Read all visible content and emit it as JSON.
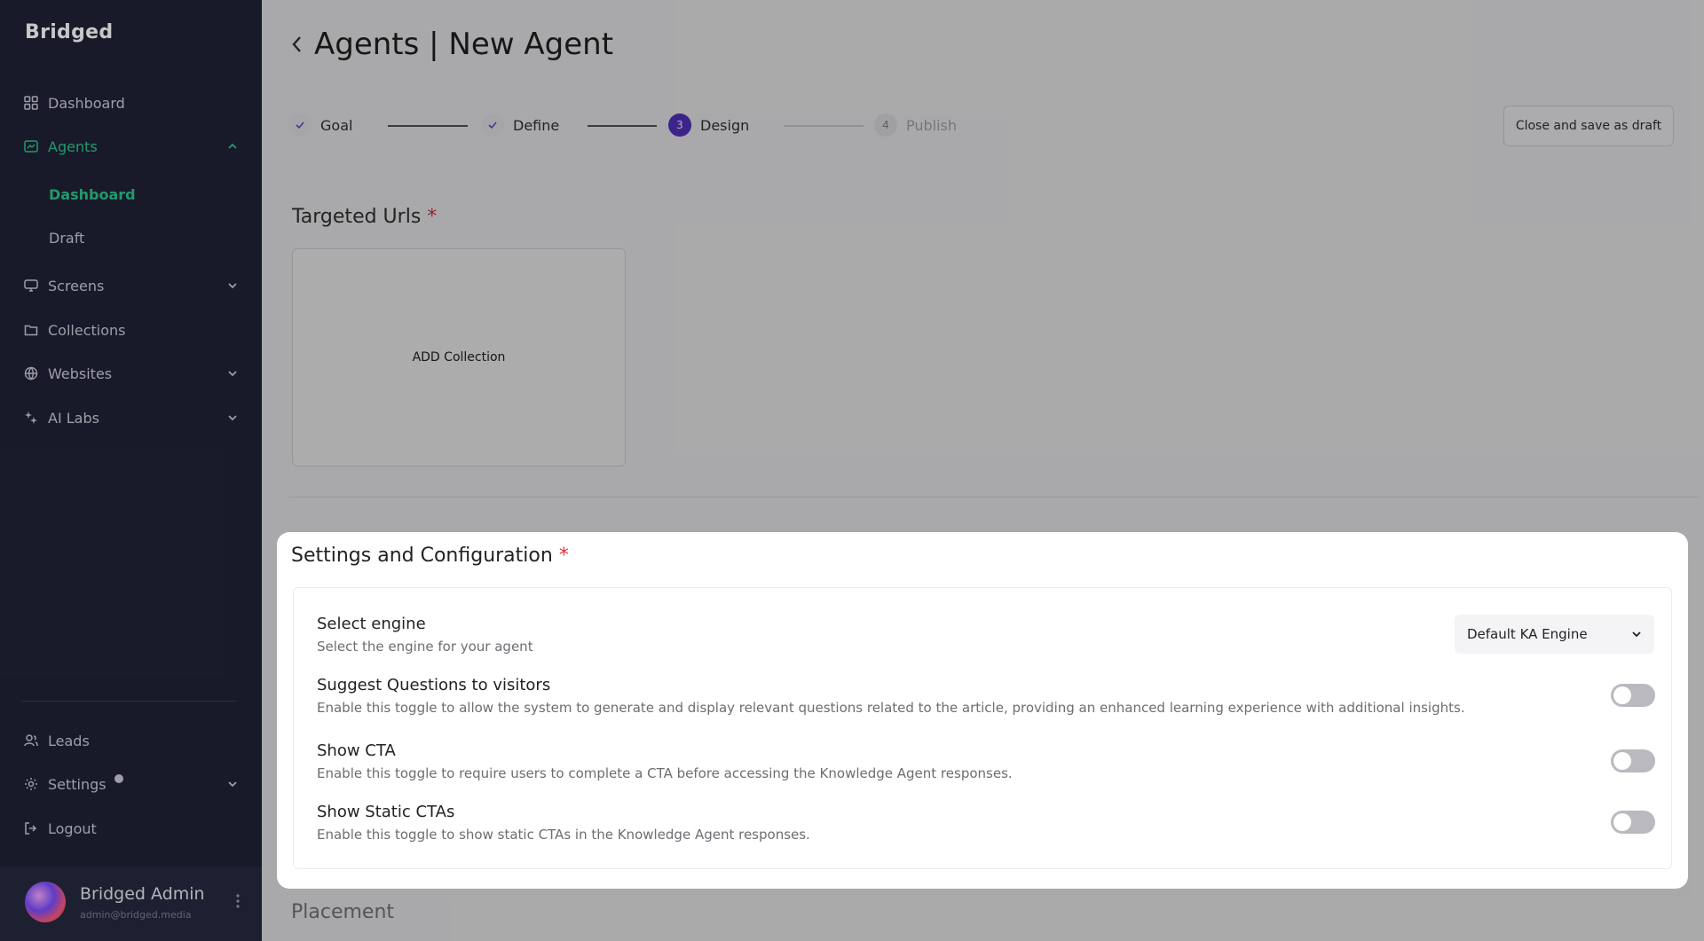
{
  "sidebar": {
    "logo": "Bridged",
    "items": [
      {
        "label": "Dashboard",
        "icon": "grid-icon"
      },
      {
        "label": "Agents",
        "icon": "agents-icon",
        "active": true,
        "expanded": true,
        "children": [
          {
            "label": "Dashboard",
            "active": true
          },
          {
            "label": "Draft"
          }
        ]
      },
      {
        "label": "Screens",
        "icon": "monitor-icon"
      },
      {
        "label": "Collections",
        "icon": "folder-icon"
      },
      {
        "label": "Websites",
        "icon": "globe-icon"
      },
      {
        "label": "AI Labs",
        "icon": "sparkle-icon"
      }
    ],
    "bottom_items": [
      {
        "label": "Leads",
        "icon": "leads-icon"
      },
      {
        "label": "Settings",
        "icon": "gear-icon"
      },
      {
        "label": "Logout",
        "icon": "logout-icon"
      }
    ],
    "user": {
      "name": "Bridged Admin",
      "email": "admin@bridged.media"
    }
  },
  "header": {
    "title": "Agents | New Agent",
    "close_draft": "Close and save as draft"
  },
  "steps": [
    {
      "label": "Goal",
      "state": "done"
    },
    {
      "label": "Define",
      "state": "done"
    },
    {
      "label": "Design",
      "state": "current",
      "number": "3"
    },
    {
      "label": "Publish",
      "state": "todo",
      "number": "4"
    }
  ],
  "targeted": {
    "title": "Targeted Urls",
    "required": "*",
    "add_label": "ADD Collection"
  },
  "settings": {
    "title": "Settings and Configuration",
    "required": "*",
    "engine": {
      "label": "Select engine",
      "desc": "Select the engine for your agent",
      "value": "Default KA Engine"
    },
    "suggest": {
      "label": "Suggest Questions to visitors",
      "desc": "Enable this toggle to allow the system to generate and display relevant questions related to the article, providing an enhanced learning experience with additional insights.",
      "on": false
    },
    "cta": {
      "label": "Show CTA",
      "desc": "Enable this toggle to require users to complete a CTA before accessing the Knowledge Agent responses.",
      "on": false
    },
    "static_cta": {
      "label": "Show Static CTAs",
      "desc": "Enable this toggle to show static CTAs in the Knowledge Agent responses.",
      "on": false
    }
  },
  "placement": {
    "title": "Placement"
  },
  "colors": {
    "accent": "#5533c4",
    "active_green": "#2dc58a",
    "sidebar_bg": "#1f2235",
    "required": "#e0333a"
  }
}
